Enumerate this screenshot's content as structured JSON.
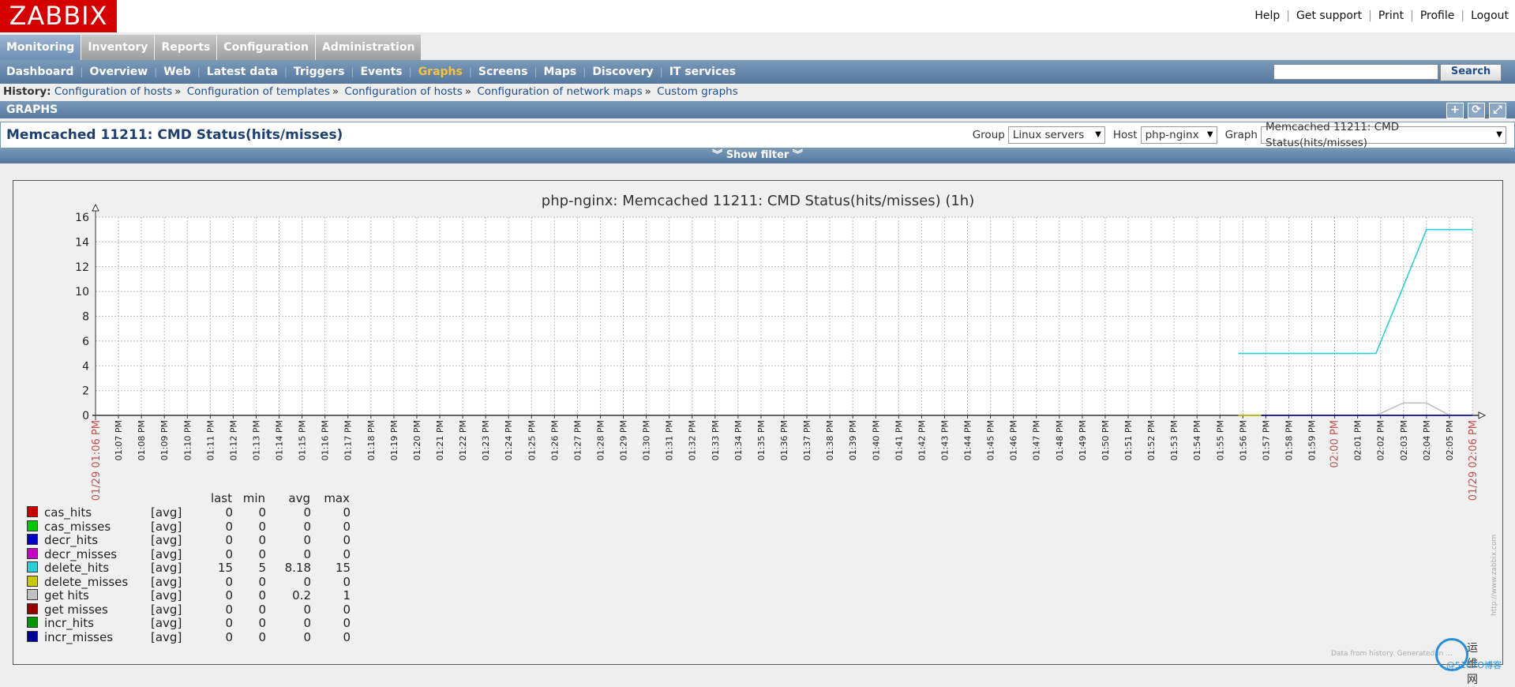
{
  "logo": "ZABBIX",
  "top_links": [
    "Help",
    "Get support",
    "Print",
    "Profile",
    "Logout"
  ],
  "main_menu": [
    {
      "label": "Monitoring",
      "active": true
    },
    {
      "label": "Inventory",
      "active": false
    },
    {
      "label": "Reports",
      "active": false
    },
    {
      "label": "Configuration",
      "active": false
    },
    {
      "label": "Administration",
      "active": false
    }
  ],
  "sub_menu": [
    {
      "label": "Dashboard",
      "active": false
    },
    {
      "label": "Overview",
      "active": false
    },
    {
      "label": "Web",
      "active": false
    },
    {
      "label": "Latest data",
      "active": false
    },
    {
      "label": "Triggers",
      "active": false
    },
    {
      "label": "Events",
      "active": false
    },
    {
      "label": "Graphs",
      "active": true
    },
    {
      "label": "Screens",
      "active": false
    },
    {
      "label": "Maps",
      "active": false
    },
    {
      "label": "Discovery",
      "active": false
    },
    {
      "label": "IT services",
      "active": false
    }
  ],
  "search": {
    "placeholder": "",
    "button": "Search"
  },
  "history": {
    "label": "History:",
    "items": [
      "Configuration of hosts",
      "Configuration of templates",
      "Configuration of hosts",
      "Configuration of network maps",
      "Custom graphs"
    ],
    "separator": "»"
  },
  "graphs_header": "GRAPHS",
  "header_icons": [
    "plus-icon",
    "refresh-icon",
    "fullscreen-icon"
  ],
  "page_title": "Memcached 11211: CMD Status(hits/misses)",
  "filters": {
    "group_label": "Group",
    "group_value": "Linux servers",
    "host_label": "Host",
    "host_value": "php-nginx",
    "graph_label": "Graph",
    "graph_value": "Memcached 11211: CMD Status(hits/misses)"
  },
  "show_filter": "Show filter",
  "colors": {
    "brand_red": "#d40000",
    "header_blue": "#56789f",
    "active_link": "#f5c243",
    "grid_background": "#ffffff",
    "date_label": "#c0504d"
  },
  "chart_data": {
    "type": "line",
    "title": "php-nginx: Memcached 11211: CMD Status(hits/misses) (1h)",
    "ylim": [
      0,
      16
    ],
    "y_ticks": [
      0,
      2,
      4,
      6,
      8,
      10,
      12,
      14,
      16
    ],
    "x_start_label": "01/29 01:06 PM",
    "x_end_label": "01/29 02:06 PM",
    "x_highlight_label": "02:00 PM",
    "x_tick_labels": [
      "01:07 PM",
      "01:08 PM",
      "01:09 PM",
      "01:10 PM",
      "01:11 PM",
      "01:12 PM",
      "01:13 PM",
      "01:14 PM",
      "01:15 PM",
      "01:16 PM",
      "01:17 PM",
      "01:18 PM",
      "01:19 PM",
      "01:20 PM",
      "01:21 PM",
      "01:22 PM",
      "01:23 PM",
      "01:24 PM",
      "01:25 PM",
      "01:26 PM",
      "01:27 PM",
      "01:28 PM",
      "01:29 PM",
      "01:30 PM",
      "01:31 PM",
      "01:32 PM",
      "01:33 PM",
      "01:34 PM",
      "01:35 PM",
      "01:36 PM",
      "01:37 PM",
      "01:38 PM",
      "01:39 PM",
      "01:40 PM",
      "01:41 PM",
      "01:42 PM",
      "01:43 PM",
      "01:44 PM",
      "01:45 PM",
      "01:46 PM",
      "01:47 PM",
      "01:48 PM",
      "01:49 PM",
      "01:50 PM",
      "01:51 PM",
      "01:52 PM",
      "01:53 PM",
      "01:54 PM",
      "01:55 PM",
      "01:56 PM",
      "01:57 PM",
      "01:58 PM",
      "01:59 PM",
      "02:00 PM",
      "02:01 PM",
      "02:02 PM",
      "02:03 PM",
      "02:04 PM",
      "02:05 PM"
    ],
    "grid": true,
    "legend_headers": [
      "last",
      "min",
      "avg",
      "max"
    ],
    "series": [
      {
        "name": "cas_hits",
        "color": "#c80000",
        "fn": "[avg]",
        "last": "0",
        "min": "0",
        "avg": "0",
        "max": "0",
        "points": []
      },
      {
        "name": "cas_misses",
        "color": "#00c800",
        "fn": "[avg]",
        "last": "0",
        "min": "0",
        "avg": "0",
        "max": "0",
        "points": []
      },
      {
        "name": "decr_hits",
        "color": "#0000c8",
        "fn": "[avg]",
        "last": "0",
        "min": "0",
        "avg": "0",
        "max": "0",
        "points": []
      },
      {
        "name": "decr_misses",
        "color": "#c800c8",
        "fn": "[avg]",
        "last": "0",
        "min": "0",
        "avg": "0",
        "max": "0",
        "points": []
      },
      {
        "name": "delete_hits",
        "color": "#2ad0d6",
        "fn": "[avg]",
        "last": "15",
        "min": "5",
        "avg": "8.18",
        "max": "15",
        "points": [
          [
            49.8,
            5
          ],
          [
            55.8,
            5
          ],
          [
            58,
            15
          ],
          [
            60,
            15
          ]
        ]
      },
      {
        "name": "delete_misses",
        "color": "#c8c800",
        "fn": "[avg]",
        "last": "0",
        "min": "0",
        "avg": "0",
        "max": "0",
        "points": [
          [
            49.8,
            0
          ],
          [
            50.8,
            0
          ]
        ]
      },
      {
        "name": "get hits",
        "color": "#c0c0c0",
        "fn": "[avg]",
        "last": "0",
        "min": "0",
        "avg": "0.2",
        "max": "1",
        "points": [
          [
            55.8,
            0
          ],
          [
            57,
            1
          ],
          [
            58,
            1
          ],
          [
            59,
            0
          ],
          [
            60,
            0
          ]
        ]
      },
      {
        "name": "get misses",
        "color": "#960000",
        "fn": "[avg]",
        "last": "0",
        "min": "0",
        "avg": "0",
        "max": "0",
        "points": []
      },
      {
        "name": "incr_hits",
        "color": "#009600",
        "fn": "[avg]",
        "last": "0",
        "min": "0",
        "avg": "0",
        "max": "0",
        "points": []
      },
      {
        "name": "incr_misses",
        "color": "#000096",
        "fn": "[avg]",
        "last": "0",
        "min": "0",
        "avg": "0",
        "max": "0",
        "points": [
          [
            50.8,
            0
          ],
          [
            60,
            0
          ]
        ]
      }
    ]
  },
  "footnote": "Data from history. Generated in ...",
  "side_url": "http://www.zabbix.com",
  "watermark": {
    "text": "运维网",
    "sub": "@51CTO博客"
  }
}
